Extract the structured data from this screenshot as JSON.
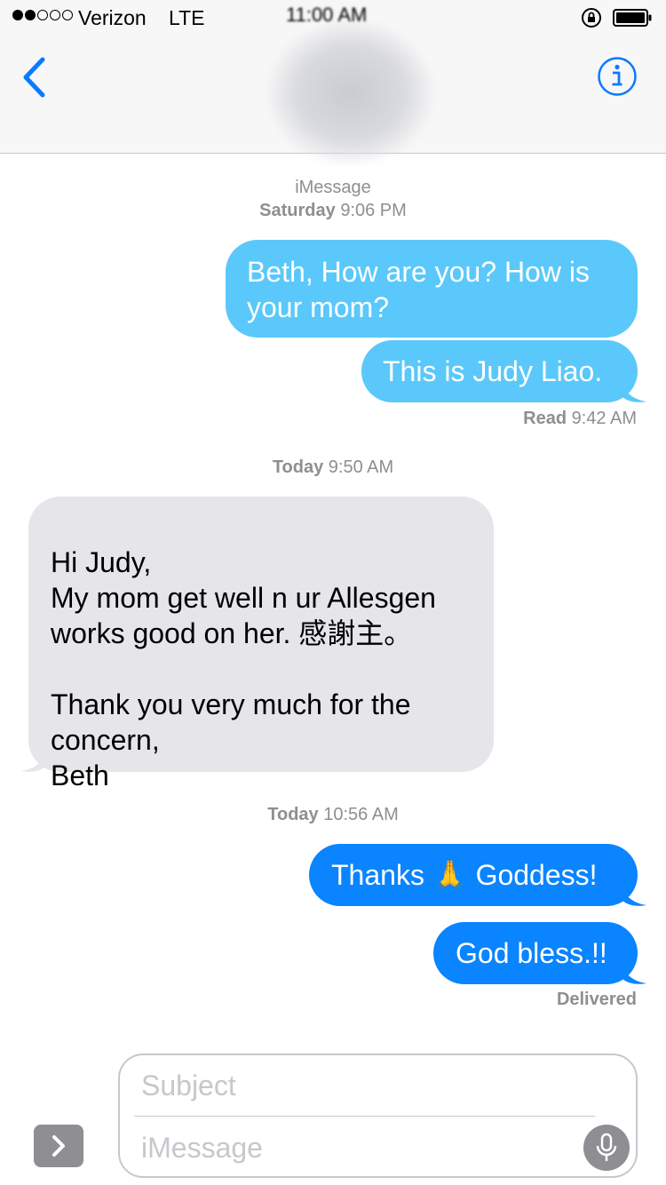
{
  "status_bar": {
    "carrier": "Verizon",
    "network": "LTE",
    "time": "11:00 AM"
  },
  "conversation": {
    "service_label": "iMessage",
    "messages": [
      {
        "text": "Beth, How are you? How is your mom?"
      },
      {
        "text": "This is Judy Liao."
      },
      {
        "text": "Hi Judy,\nMy mom get well n ur Allesgen works good on her. 感謝主。\n\nThank you very much for the concern,\nBeth"
      },
      {
        "text_before": "Thanks",
        "emoji": "🙏",
        "text_after": "Goddess!"
      },
      {
        "text": "God bless.!!"
      }
    ],
    "timestamps": [
      {
        "day": "Saturday",
        "time": "9:06 PM"
      },
      {
        "day": "Today",
        "time": "9:50 AM"
      },
      {
        "day": "Today",
        "time": "10:56 AM"
      }
    ],
    "receipts": [
      {
        "label": "Read",
        "time": "9:42 AM"
      },
      {
        "label": "Delivered"
      }
    ]
  },
  "composer": {
    "subject_placeholder": "Subject",
    "message_placeholder": "iMessage"
  },
  "colors": {
    "sms_blue": "#5ac8fa",
    "imessage_blue": "#0a84ff",
    "received_gray": "#e5e5ea",
    "accent": "#0a7aff"
  }
}
